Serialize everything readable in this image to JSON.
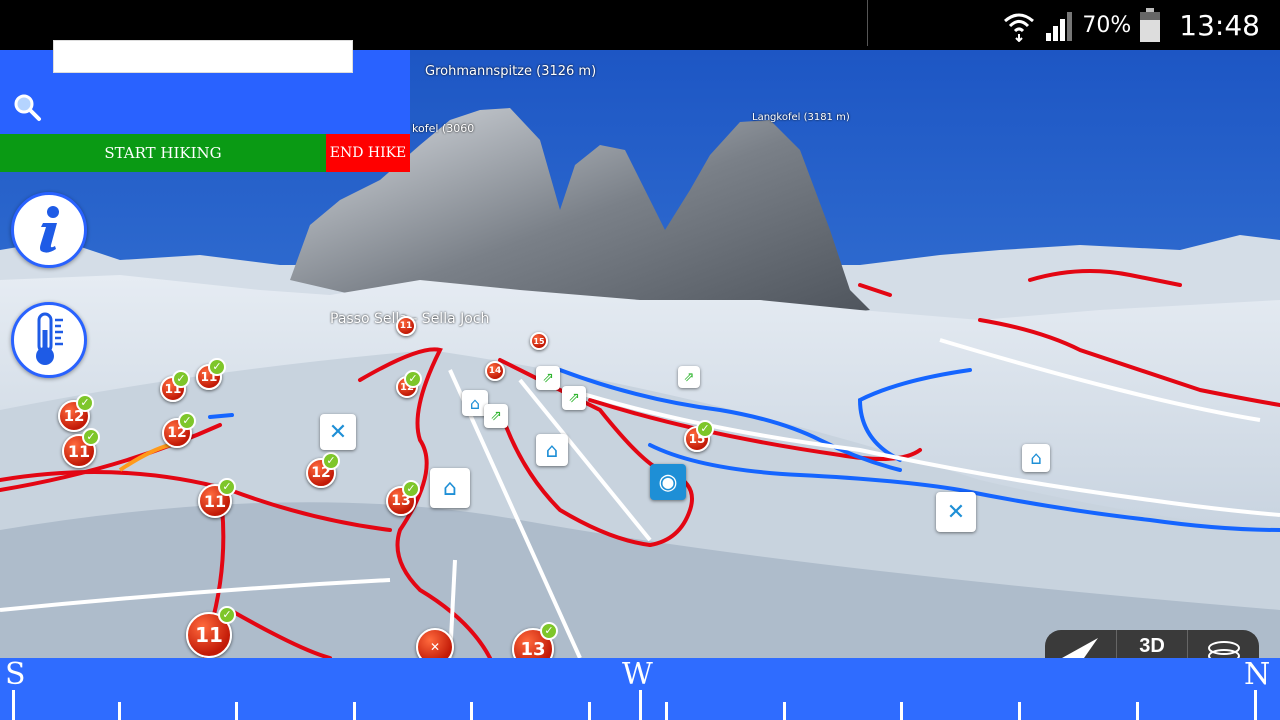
{
  "status_bar": {
    "battery_percent": "70%",
    "clock": "13:48",
    "icons": [
      "wifi-icon",
      "signal-icon",
      "battery-icon"
    ]
  },
  "map": {
    "peaks": [
      {
        "label": "Grohmannspitze (3126 m)"
      },
      {
        "label": "Langkofel (3181 m)"
      },
      {
        "label": "kofel (3060"
      }
    ],
    "pass_label": "Passo Sella - Sella Joch",
    "trail_markers": [
      "11",
      "12",
      "11",
      "12",
      "11",
      "12",
      "11",
      "11",
      "11",
      "13",
      "12",
      "13",
      "14",
      "15",
      "15",
      "13"
    ],
    "poi_icons": [
      "hut-icon",
      "restaurant-icon",
      "lift-icon",
      "webcam-icon"
    ]
  },
  "search": {
    "value": "",
    "placeholder": ""
  },
  "hike": {
    "start_label": "START HIKING",
    "end_label": "END HIKE"
  },
  "buttons": {
    "info_icon": "info-icon",
    "temperature_icon": "thermometer-icon"
  },
  "map_controls": {
    "compass_mode_icon": "navigation-arrow-icon",
    "view_label": "3D",
    "layers_icon": "layers-icon"
  },
  "compass": {
    "left": "S",
    "center": "W",
    "right": "N"
  },
  "colors": {
    "panel_blue": "#2962ff",
    "start_green": "#0a9a14",
    "end_red": "#ff0000",
    "sky_blue": "#2466c9",
    "trail_red": "#e30613",
    "trail_blue": "#1565ff"
  }
}
